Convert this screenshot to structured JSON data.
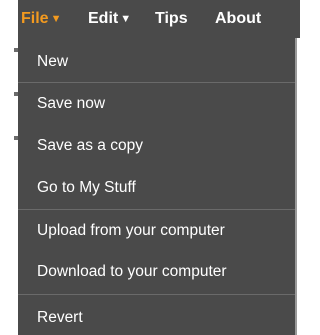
{
  "menubar": {
    "items": [
      {
        "label": "File",
        "caret": "▼"
      },
      {
        "label": "Edit",
        "caret": "▼"
      },
      {
        "label": "Tips"
      },
      {
        "label": "About"
      }
    ]
  },
  "file_menu": {
    "items": [
      {
        "label": "New"
      },
      {
        "label": "Save now"
      },
      {
        "label": "Save as a copy"
      },
      {
        "label": "Go to My Stuff"
      },
      {
        "label": "Upload from your computer"
      },
      {
        "label": "Download to your computer"
      },
      {
        "label": "Revert"
      }
    ]
  },
  "colors": {
    "menu_background": "#4a4a4a",
    "active_menu_text": "#f39a1f",
    "menu_text": "#ffffff",
    "separator": "#6a6a6a"
  }
}
